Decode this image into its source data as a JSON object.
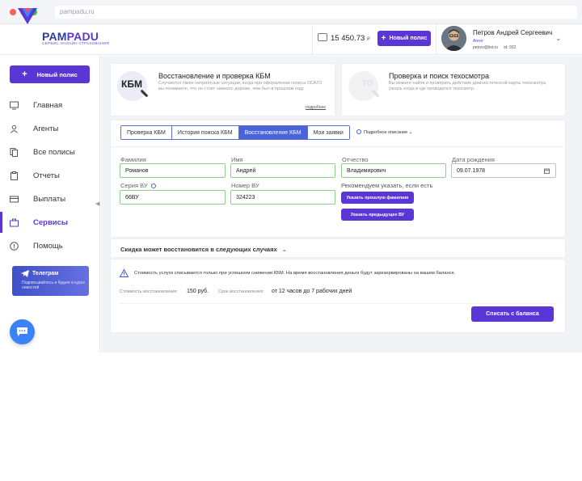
{
  "browser": {
    "url": "pampadu.ru"
  },
  "header": {
    "logo_name": "PAMPADU",
    "logo_subtitle": "СЕРВИС ОНЛАЙН СТРАХОВАНИЯ",
    "balance": "15 450.73",
    "currency": "₽",
    "new_policy_label": "Новый полис",
    "user": {
      "name": "Петров Андрей Сергеевич",
      "role": "Агент",
      "email": "petrov@list.ru",
      "id": "id: 932"
    }
  },
  "sidebar": {
    "new_policy_label": "Новый полис",
    "items": [
      {
        "label": "Главная",
        "icon": "monitor-icon"
      },
      {
        "label": "Агенты",
        "icon": "user-icon"
      },
      {
        "label": "Все полисы",
        "icon": "copy-icon"
      },
      {
        "label": "Отчеты",
        "icon": "clipboard-icon"
      },
      {
        "label": "Выплаты",
        "icon": "card-icon"
      },
      {
        "label": "Сервисы",
        "icon": "briefcase-icon",
        "active": true
      },
      {
        "label": "Помощь",
        "icon": "help-icon"
      }
    ],
    "telegram": {
      "title": "Телеграм",
      "subtitle": "Подписывайтесь и будьте в курсе новостей"
    }
  },
  "services": [
    {
      "title": "Восстановление и проверка КБМ",
      "icon_text": "КБМ",
      "text": "Случаются такие неприятные ситуации, когда при оформлении полиса ОСАГО вы понимаете, что он стоит намного дороже, чем был в прошлом году.",
      "more": "подробнее"
    },
    {
      "title": "Проверка и поиск техосмотра",
      "icon_text": "ТО",
      "text": "Вы можете найти и проверить действие диагностической карты техосмотра, узнать когда и где проводился техосмотр."
    }
  ],
  "tabs": [
    "Проверка КБМ",
    "История поиска КБМ",
    "Восстановление КБМ",
    "Мои заявки"
  ],
  "detail_link": "Подробное описание",
  "form": {
    "last_name": {
      "label": "Фамилия",
      "value": "Романов"
    },
    "first_name": {
      "label": "Имя",
      "value": "Андрей"
    },
    "patronymic": {
      "label": "Отчество",
      "value": "Владимирович"
    },
    "birth_date": {
      "label": "Дата рождения",
      "value": "09.07.1978"
    },
    "license_series": {
      "label": "Серия ВУ",
      "value": "66ВУ"
    },
    "license_number": {
      "label": "Номер ВУ",
      "value": "324223"
    },
    "recommend": "Рекомендуем указать, если есть",
    "prev_last_name_btn": "Указать прошлую фамилию",
    "prev_license_btn": "Указать предыдущее ВУ"
  },
  "discount_title": "Скидка может восстановится в следующих случаях",
  "notice": "Стоимость услуги списывается только при успешном снижении КБМ. На время восстановления деньги будут зарезервированы на вашем балансе.",
  "cost": {
    "label": "Стоимость восстановления:",
    "value": "150 руб.",
    "term_label": "Срок восстановления:",
    "term_value": "от 12 часов до 7 рабочих дней"
  },
  "submit_label": "Списать с баланса",
  "colors": {
    "accent": "#5b36d6",
    "tab_active": "#4a63d8",
    "valid_border": "#8fcf8f"
  }
}
